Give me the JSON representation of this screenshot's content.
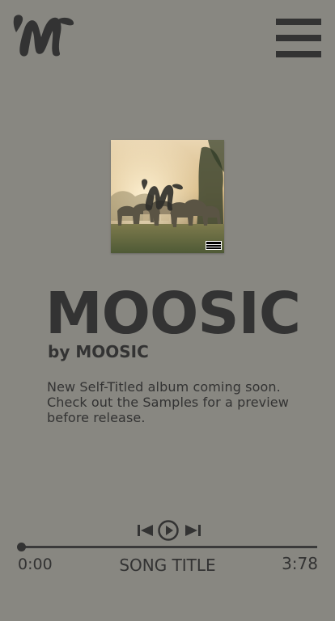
{
  "header": {
    "logo_icon": "moosic-logo-icon",
    "menu_icon": "hamburger-menu-icon"
  },
  "album": {
    "cover_icon": "album-cover-image",
    "title": "MOOSIC",
    "artist_line": "by MOOSIC",
    "description": "New Self-Titled album coming soon. Check out the Samples for a preview before release."
  },
  "player": {
    "prev_icon": "skip-previous-icon",
    "play_icon": "play-icon",
    "next_icon": "skip-next-icon",
    "current_time": "0:00",
    "song_title": "SONG TITLE",
    "total_time": "3:78",
    "progress": 0
  },
  "colors": {
    "background": "#888781",
    "foreground": "#333333"
  }
}
